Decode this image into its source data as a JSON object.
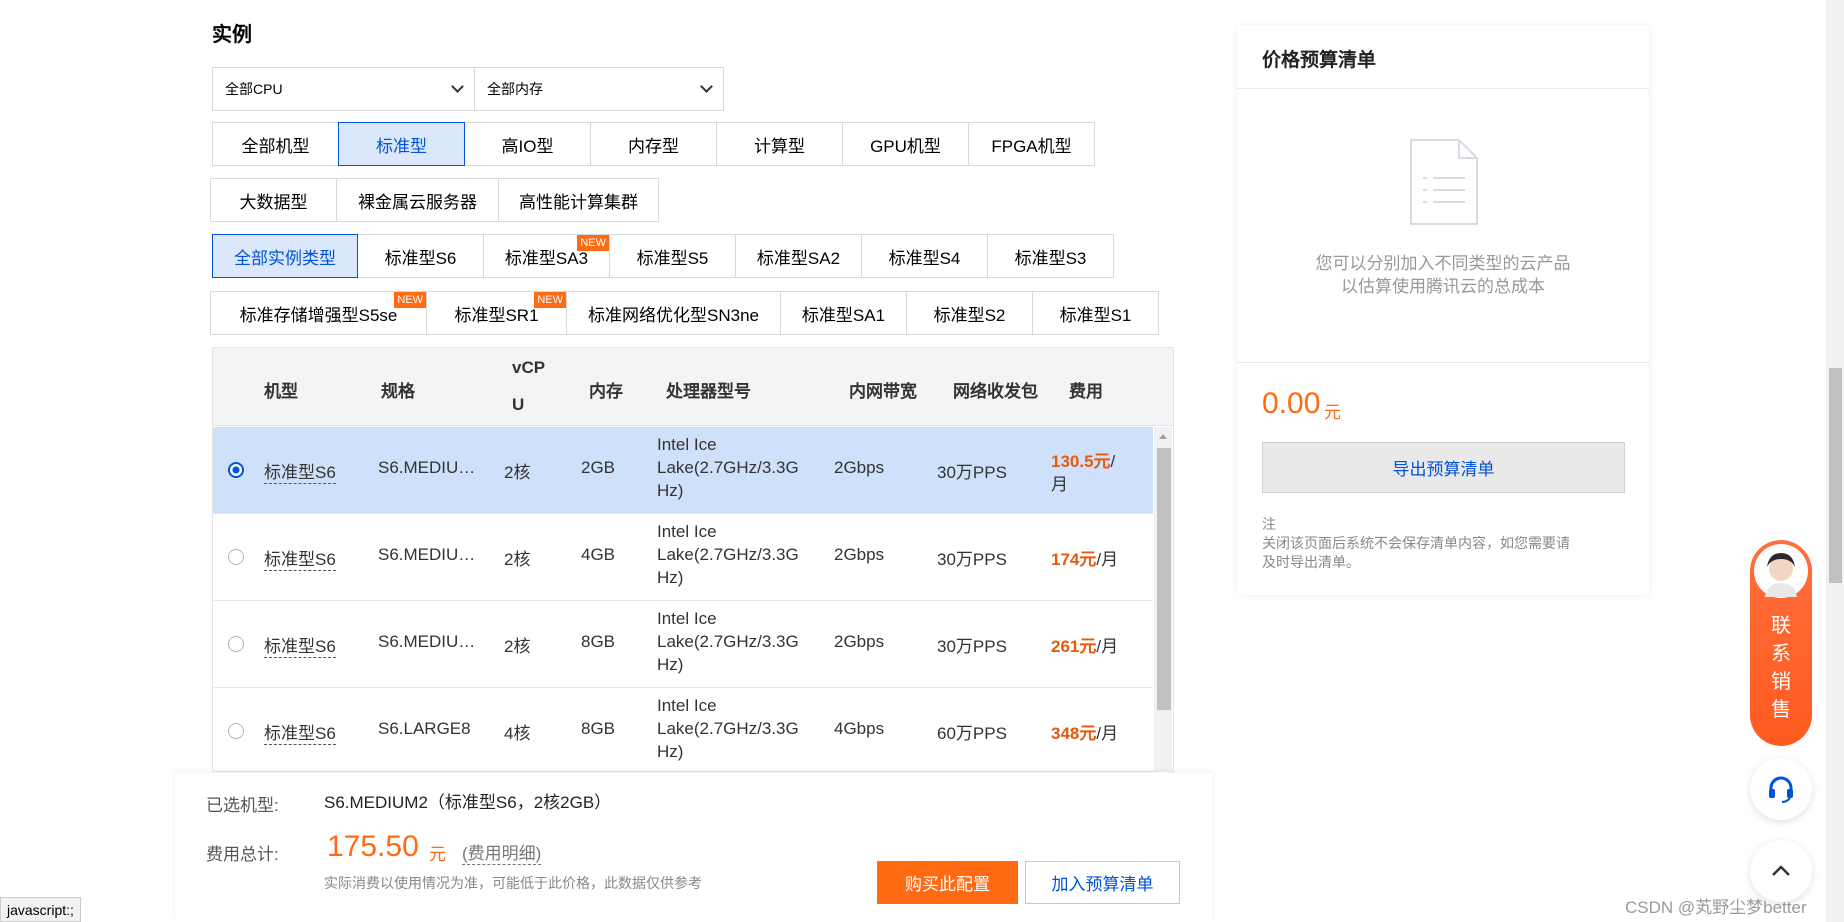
{
  "section_title": "实例",
  "filters": {
    "cpu": "全部CPU",
    "memory": "全部内存"
  },
  "category_tabs_row1": [
    "全部机型",
    "标准型",
    "高IO型",
    "内存型",
    "计算型",
    "GPU机型",
    "FPGA机型"
  ],
  "category_tabs_row2": [
    "大数据型",
    "裸金属云服务器",
    "高性能计算集群"
  ],
  "type_tabs_row1": [
    "全部实例类型",
    "标准型S6",
    "标准型SA3",
    "标准型S5",
    "标准型SA2",
    "标准型S4",
    "标准型S3"
  ],
  "type_tabs_row2": [
    "标准存储增强型S5se",
    "标准型SR1",
    "标准网络优化型SN3ne",
    "标准型SA1",
    "标准型S2",
    "标准型S1"
  ],
  "new_badge": "NEW",
  "table": {
    "headers": {
      "model": "机型",
      "spec": "规格",
      "vcpu_a": "vCP",
      "vcpu_b": "U",
      "memory": "内存",
      "processor": "处理器型号",
      "bandwidth": "内网带宽",
      "pps": "网络收发包",
      "cost": "费用"
    },
    "rows": [
      {
        "model": "标准型S6",
        "spec": "S6.MEDIU…",
        "vcpu": "2核",
        "memory": "2GB",
        "proc1": "Intel Ice",
        "proc2": "Lake(2.7GHz/3.3G",
        "proc3": "Hz)",
        "bandwidth": "2Gbps",
        "pps": "30万PPS",
        "price": "130.5元",
        "price_unit": "/",
        "price_unit2": "月",
        "selected": true
      },
      {
        "model": "标准型S6",
        "spec": "S6.MEDIU…",
        "vcpu": "2核",
        "memory": "4GB",
        "proc1": "Intel Ice",
        "proc2": "Lake(2.7GHz/3.3G",
        "proc3": "Hz)",
        "bandwidth": "2Gbps",
        "pps": "30万PPS",
        "price": "174元",
        "price_unit": "/月",
        "selected": false
      },
      {
        "model": "标准型S6",
        "spec": "S6.MEDIU…",
        "vcpu": "2核",
        "memory": "8GB",
        "proc1": "Intel Ice",
        "proc2": "Lake(2.7GHz/3.3G",
        "proc3": "Hz)",
        "bandwidth": "2Gbps",
        "pps": "30万PPS",
        "price": "261元",
        "price_unit": "/月",
        "selected": false
      },
      {
        "model": "标准型S6",
        "spec": "S6.LARGE8",
        "vcpu": "4核",
        "memory": "8GB",
        "proc1": "Intel Ice",
        "proc2": "Lake(2.7GHz/3.3G",
        "proc3": "Hz)",
        "bandwidth": "4Gbps",
        "pps": "60万PPS",
        "price": "348元",
        "price_unit": "/月",
        "selected": false
      }
    ]
  },
  "bottom": {
    "selected_label": "已选机型:",
    "selected_value": "S6.MEDIUM2（标准型S6，2核2GB）",
    "total_label": "费用总计:",
    "total_amount": "175.50",
    "total_unit": "元",
    "detail_link": "(费用明细)",
    "note": "实际消费以使用情况为准，可能低于此价格，此数据仅供参考",
    "buy_button": "购买此配置",
    "add_button": "加入预算清单"
  },
  "panel": {
    "title": "价格预算清单",
    "empty_line1": "您可以分别加入不同类型的云产品",
    "empty_line2": "以估算使用腾讯云的总成本",
    "amount": "0.00",
    "amount_unit": "元",
    "export_button": "导出预算清单",
    "note_title": "注",
    "note_line1": "关闭该页面后系统不会保存清单内容，如您需要请",
    "note_line2": "及时导出清单。"
  },
  "float": {
    "contact_c1": "联",
    "contact_c2": "系",
    "contact_c3": "销",
    "contact_c4": "售"
  },
  "status_bar": "javascript:;",
  "watermark": "CSDN @芄野尘梦better",
  "colors": {
    "accent_blue": "#0052d9",
    "price_orange": "#e8590c",
    "button_orange": "#ff6a13",
    "selected_row": "#cfe0fb"
  }
}
